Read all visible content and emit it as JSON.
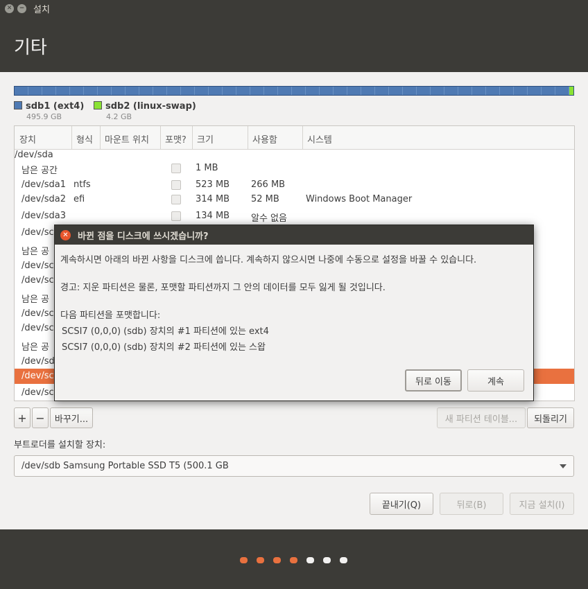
{
  "window": {
    "title": "설치"
  },
  "header": {
    "title": "기타"
  },
  "legend": [
    {
      "name": "sdb1 (ext4)",
      "size": "495.9 GB",
      "color": "#4f7ab3"
    },
    {
      "name": "sdb2 (linux-swap)",
      "size": "4.2 GB",
      "color": "#8ae234"
    }
  ],
  "table": {
    "columns": [
      "장치",
      "형식",
      "마운트 위치",
      "포맷?",
      "크기",
      "사용함",
      "시스템"
    ],
    "rows": [
      {
        "device": "/dev/sda",
        "type": "",
        "mount": "",
        "size": "",
        "used": "",
        "system": "",
        "checkbox": false
      },
      {
        "device": "남은 공간",
        "type": "",
        "mount": "",
        "size": "1 MB",
        "used": "",
        "system": "",
        "checkbox": true
      },
      {
        "device": "/dev/sda1",
        "type": "ntfs",
        "mount": "",
        "size": "523 MB",
        "used": "266 MB",
        "system": "",
        "checkbox": true
      },
      {
        "device": "/dev/sda2",
        "type": "efi",
        "mount": "",
        "size": "314 MB",
        "used": "52 MB",
        "system": "Windows Boot Manager",
        "checkbox": true
      },
      {
        "device": "/dev/sda3",
        "type": "",
        "mount": "",
        "size": "134 MB",
        "used": "알수 없음",
        "system": "",
        "checkbox": true
      },
      {
        "device": "/dev/sc",
        "type": "",
        "mount": "",
        "size": "",
        "used": "",
        "system": "",
        "checkbox": false
      },
      {
        "device": "남은 공",
        "type": "",
        "mount": "",
        "size": "",
        "used": "",
        "system": "",
        "checkbox": false
      },
      {
        "device": "/dev/sc",
        "type": "",
        "mount": "",
        "size": "",
        "used": "",
        "system": "",
        "checkbox": false
      },
      {
        "device": "/dev/sc",
        "type": "",
        "mount": "",
        "size": "",
        "used": "",
        "system": "",
        "checkbox": false
      },
      {
        "device": "남은 공",
        "type": "",
        "mount": "",
        "size": "",
        "used": "",
        "system": "",
        "checkbox": false
      },
      {
        "device": "/dev/sc",
        "type": "",
        "mount": "",
        "size": "",
        "used": "",
        "system": "",
        "checkbox": false
      },
      {
        "device": "/dev/sc",
        "type": "",
        "mount": "",
        "size": "",
        "used": "",
        "system": "",
        "checkbox": false
      },
      {
        "device": "남은 공",
        "type": "",
        "mount": "",
        "size": "",
        "used": "",
        "system": "",
        "checkbox": false
      },
      {
        "device": "/dev/sdl",
        "type": "",
        "mount": "",
        "size": "",
        "used": "",
        "system": "",
        "checkbox": false
      },
      {
        "device": "/dev/sc",
        "type": "",
        "mount": "",
        "size": "",
        "used": "",
        "system": "",
        "checkbox": false,
        "selected": true
      },
      {
        "device": "/dev/sc",
        "type": "",
        "mount": "",
        "size": "",
        "used": "",
        "system": "",
        "checkbox": false
      }
    ]
  },
  "table_buttons": {
    "add": "+",
    "remove": "−",
    "change": "바꾸기...",
    "new_table": "새 파티션 테이블...",
    "revert": "되돌리기"
  },
  "bootloader": {
    "label": "부트로더를 설치할 장치:",
    "value": "/dev/sdb   Samsung Portable SSD T5 (500.1 GB"
  },
  "nav_buttons": {
    "quit": "끝내기(Q)",
    "back": "뒤로(B)",
    "install": "지금 설치(I)"
  },
  "progress": {
    "total_steps": 7,
    "completed_steps": 4,
    "done_color": "#e9713f"
  },
  "dialog": {
    "title": "바뀐 점을 디스크에 쓰시겠습니까?",
    "line1": "계속하시면 아래의 바뀐 사항을 디스크에 씁니다. 계속하지 않으시면 나중에 수동으로 설정을 바꿀 수 있습니다.",
    "warning": "경고: 지운 파티션은 물론, 포맷할 파티션까지 그 안의 데이터를 모두 잃게 될 것입니다.",
    "format_heading": "다음 파티션을 포맷합니다:",
    "format_items": [
      "SCSI7 (0,0,0) (sdb) 장치의 #1 파티션에 있는 ext4",
      "SCSI7 (0,0,0) (sdb) 장치의 #2 파티션에 있는 스왑"
    ],
    "go_back": "뒤로 이동",
    "continue": "계속"
  }
}
